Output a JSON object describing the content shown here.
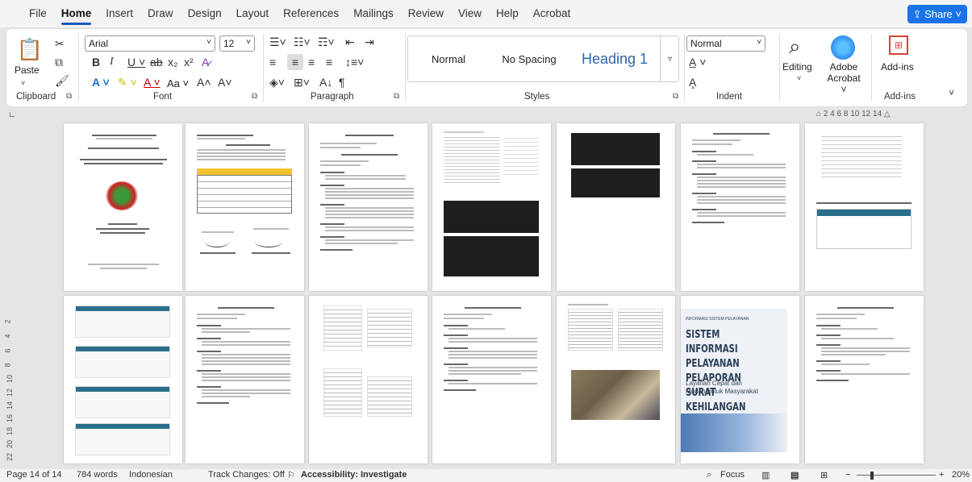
{
  "menu": {
    "tabs": [
      "File",
      "Home",
      "Insert",
      "Draw",
      "Design",
      "Layout",
      "References",
      "Mailings",
      "Review",
      "View",
      "Help",
      "Acrobat"
    ],
    "share": "Share"
  },
  "clipboard": {
    "paste": "Paste",
    "label": "Clipboard"
  },
  "font": {
    "name": "Arial",
    "size": "12",
    "label": "Font",
    "case": "Aa"
  },
  "paragraph": {
    "label": "Paragraph"
  },
  "styles": {
    "normal": "Normal",
    "nospacing": "No Spacing",
    "heading1": "Heading 1",
    "label": "Styles"
  },
  "indent": {
    "style_value": "Normal",
    "label": "Indent"
  },
  "editing": {
    "label": "Editing"
  },
  "acrobat": {
    "label1": "Adobe",
    "label2": "Acrobat"
  },
  "addins": {
    "button": "Add-ins",
    "label": "Add-ins"
  },
  "ruler": {
    "numbers": [
      "2",
      "4",
      "6",
      "8",
      "10",
      "12",
      "14"
    ]
  },
  "vruler": {
    "numbers": [
      "2",
      "4",
      "6",
      "8",
      "10",
      "12",
      "14",
      "16",
      "18",
      "20",
      "22"
    ]
  },
  "thumbnails": {
    "page11_title1": "SISTEM INFORMASI",
    "page11_title2": "PELAYANAN PELAPORAN",
    "page11_title3": "SURAT KEHILANGAN",
    "page11_sub": "Layanan Cepat dan Mudah untuk Masyarakat",
    "page11_top": "INFORMASI SISTEM PELAYANAN"
  },
  "status": {
    "page": "Page 14 of 14",
    "words": "784 words",
    "lang": "Indonesian",
    "track": "Track Changes: Off",
    "access": "Accessibility: Investigate",
    "focus": "Focus",
    "zoom": "20%"
  }
}
